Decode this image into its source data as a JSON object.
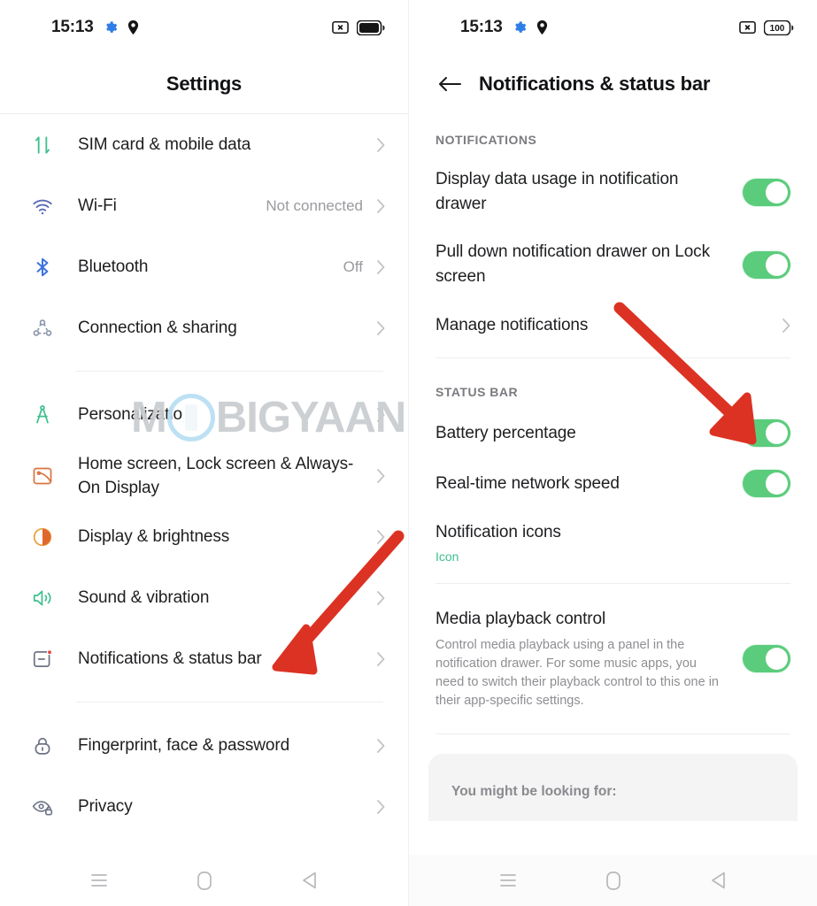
{
  "watermark": {
    "part1": "M",
    "part2": "BIGYAAN"
  },
  "left_panel": {
    "status_bar": {
      "time": "15:13",
      "gear_icon": "gear-icon",
      "location_icon": "location-pin-icon",
      "cast_icon": "cast-box-icon",
      "battery_icon": "battery-full-icon"
    },
    "header": {
      "title": "Settings"
    },
    "groups": [
      {
        "items": [
          {
            "icon": "sim-data-icon",
            "label": "SIM card & mobile data",
            "value": "",
            "chevron": true
          },
          {
            "icon": "wifi-icon",
            "label": "Wi-Fi",
            "value": "Not connected",
            "chevron": true
          },
          {
            "icon": "bluetooth-icon",
            "label": "Bluetooth",
            "value": "Off",
            "chevron": true
          },
          {
            "icon": "connection-sharing-icon",
            "label": "Connection & sharing",
            "value": "",
            "chevron": true
          }
        ]
      },
      {
        "items": [
          {
            "icon": "personalizations-icon",
            "label": "Personalizations",
            "value": "",
            "chevron": true
          },
          {
            "icon": "home-screen-icon",
            "label": "Home screen, Lock screen & Always-On Display",
            "value": "",
            "chevron": true
          },
          {
            "icon": "display-brightness-icon",
            "label": "Display & brightness",
            "value": "",
            "chevron": true
          },
          {
            "icon": "sound-vibration-icon",
            "label": "Sound & vibration",
            "value": "",
            "chevron": true
          },
          {
            "icon": "notifications-status-bar-icon",
            "label": "Notifications & status bar",
            "value": "",
            "chevron": true
          }
        ]
      },
      {
        "items": [
          {
            "icon": "fingerprint-lock-icon",
            "label": "Fingerprint, face & password",
            "value": "",
            "chevron": true
          },
          {
            "icon": "privacy-eye-icon",
            "label": "Privacy",
            "value": "",
            "chevron": true
          }
        ]
      }
    ],
    "navbar": {
      "recents_label": "recents-icon",
      "home_label": "home-icon",
      "back_label": "back-icon"
    }
  },
  "right_panel": {
    "status_bar": {
      "time": "15:13",
      "gear_icon": "gear-icon",
      "location_icon": "location-pin-icon",
      "cast_icon": "cast-box-icon",
      "battery_text": "100"
    },
    "header": {
      "back_icon": "arrow-left-icon",
      "title": "Notifications & status bar"
    },
    "sections": [
      {
        "label": "NOTIFICATIONS",
        "rows": [
          {
            "title": "Display data usage in notification drawer",
            "sub": "",
            "desc": "",
            "control": "toggle",
            "toggle_on": true
          },
          {
            "title": "Pull down notification drawer on Lock screen",
            "sub": "",
            "desc": "",
            "control": "toggle",
            "toggle_on": true
          },
          {
            "title": "Manage notifications",
            "sub": "",
            "desc": "",
            "control": "chevron",
            "toggle_on": false
          }
        ]
      },
      {
        "label": "STATUS BAR",
        "rows": [
          {
            "title": "Battery percentage",
            "sub": "",
            "desc": "",
            "control": "toggle",
            "toggle_on": true
          },
          {
            "title": "Real-time network speed",
            "sub": "",
            "desc": "",
            "control": "toggle",
            "toggle_on": true
          },
          {
            "title": "Notification icons",
            "sub": "Icon",
            "desc": "",
            "control": "none",
            "toggle_on": false
          }
        ]
      },
      {
        "label": "",
        "rows": [
          {
            "title": "Media playback control",
            "sub": "",
            "desc": "Control media playback using a panel in the notification drawer. For some music apps, you need to switch their playback control to this one in their app-specific settings.",
            "control": "toggle",
            "toggle_on": true
          }
        ]
      }
    ],
    "looking_for": {
      "title": "You might be looking for:"
    },
    "navbar": {
      "recents_label": "recents-icon",
      "home_label": "home-icon",
      "back_label": "back-icon"
    }
  },
  "annotations": {
    "arrow_color": "#DC3223",
    "arrow_left_target": "Notifications & status bar",
    "arrow_right_target": "Battery percentage"
  },
  "colors": {
    "toggle_on": "#5BCC7C",
    "accent_sub": "#3FBF8F",
    "text_primary": "#1D1E20",
    "text_secondary": "#8E8E93"
  }
}
